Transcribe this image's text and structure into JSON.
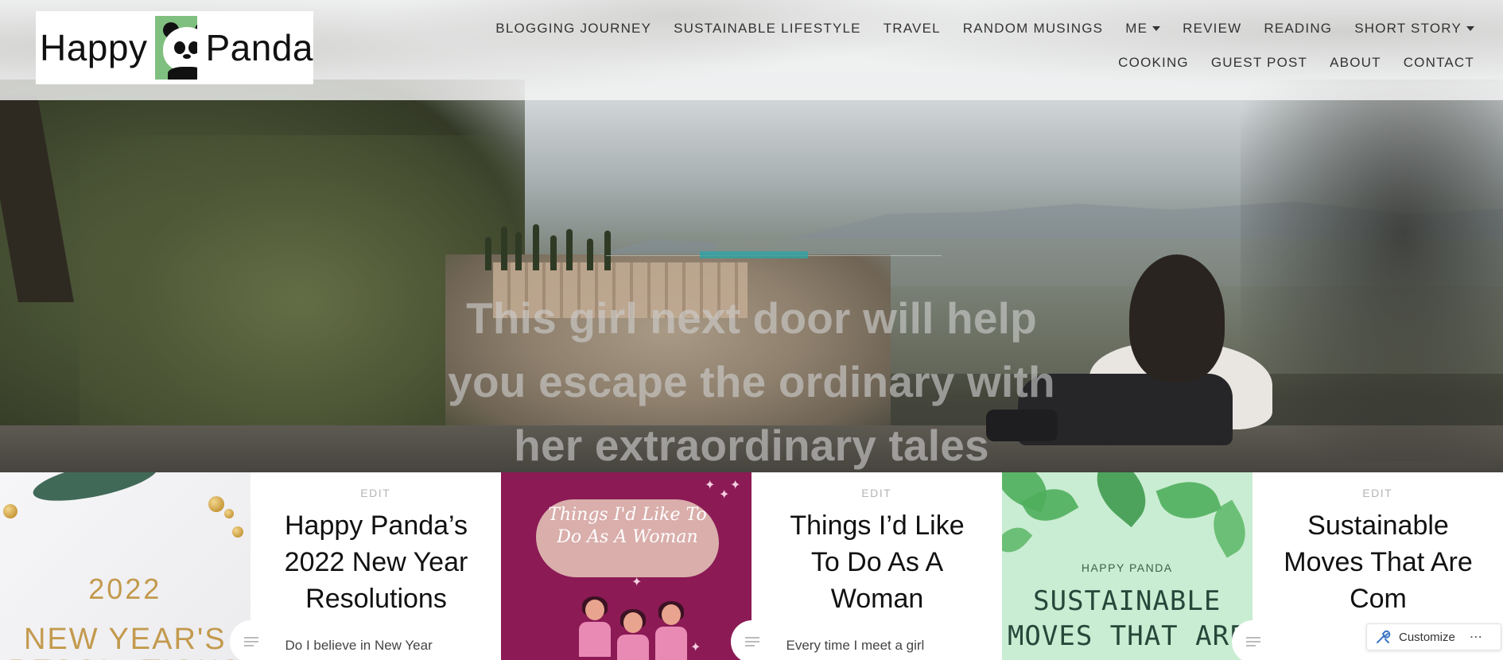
{
  "logo": {
    "word_left": "Happy",
    "word_right": "Panda"
  },
  "nav": {
    "items": [
      {
        "label": "BLOGGING JOURNEY",
        "dropdown": false
      },
      {
        "label": "SUSTAINABLE LIFESTYLE",
        "dropdown": false
      },
      {
        "label": "TRAVEL",
        "dropdown": false
      },
      {
        "label": "RANDOM MUSINGS",
        "dropdown": false
      },
      {
        "label": "ME",
        "dropdown": true
      },
      {
        "label": "REVIEW",
        "dropdown": false
      },
      {
        "label": "READING",
        "dropdown": false
      },
      {
        "label": "SHORT STORY",
        "dropdown": true
      },
      {
        "label": "COOKING",
        "dropdown": false
      },
      {
        "label": "GUEST POST",
        "dropdown": false
      },
      {
        "label": "ABOUT",
        "dropdown": false
      },
      {
        "label": "CONTACT",
        "dropdown": false
      }
    ]
  },
  "hero": {
    "tagline": "This girl next door will help you escape the ordinary with her extraordinary tales",
    "loader_progress": 0.32,
    "accent": "#2aa6a8"
  },
  "posts": [
    {
      "thumbnail": {
        "line1": "2022",
        "line2": "NEW YEAR'S RESOLUTIONS"
      },
      "edit_label": "EDIT",
      "title": "Happy Panda’s 2022 New Year Resolutions",
      "excerpt": "Do I believe in New Year",
      "format_icon": "standard-post-icon"
    },
    {
      "thumbnail": {
        "bubble": "Things I'd Like To Do As A Woman"
      },
      "edit_label": "EDIT",
      "title": "Things I’d Like To Do As A Woman",
      "excerpt": "Every time I meet a girl",
      "format_icon": "standard-post-icon"
    },
    {
      "thumbnail": {
        "brand": "HAPPY PANDA",
        "big": "SUSTAINABLE MOVES THAT ARE"
      },
      "edit_label": "EDIT",
      "title": "Sustainable Moves That Are Com",
      "excerpt": "",
      "format_icon": "standard-post-icon"
    }
  ],
  "customize": {
    "label": "Customize",
    "more": "⋯",
    "icon": "wrench-icon"
  }
}
